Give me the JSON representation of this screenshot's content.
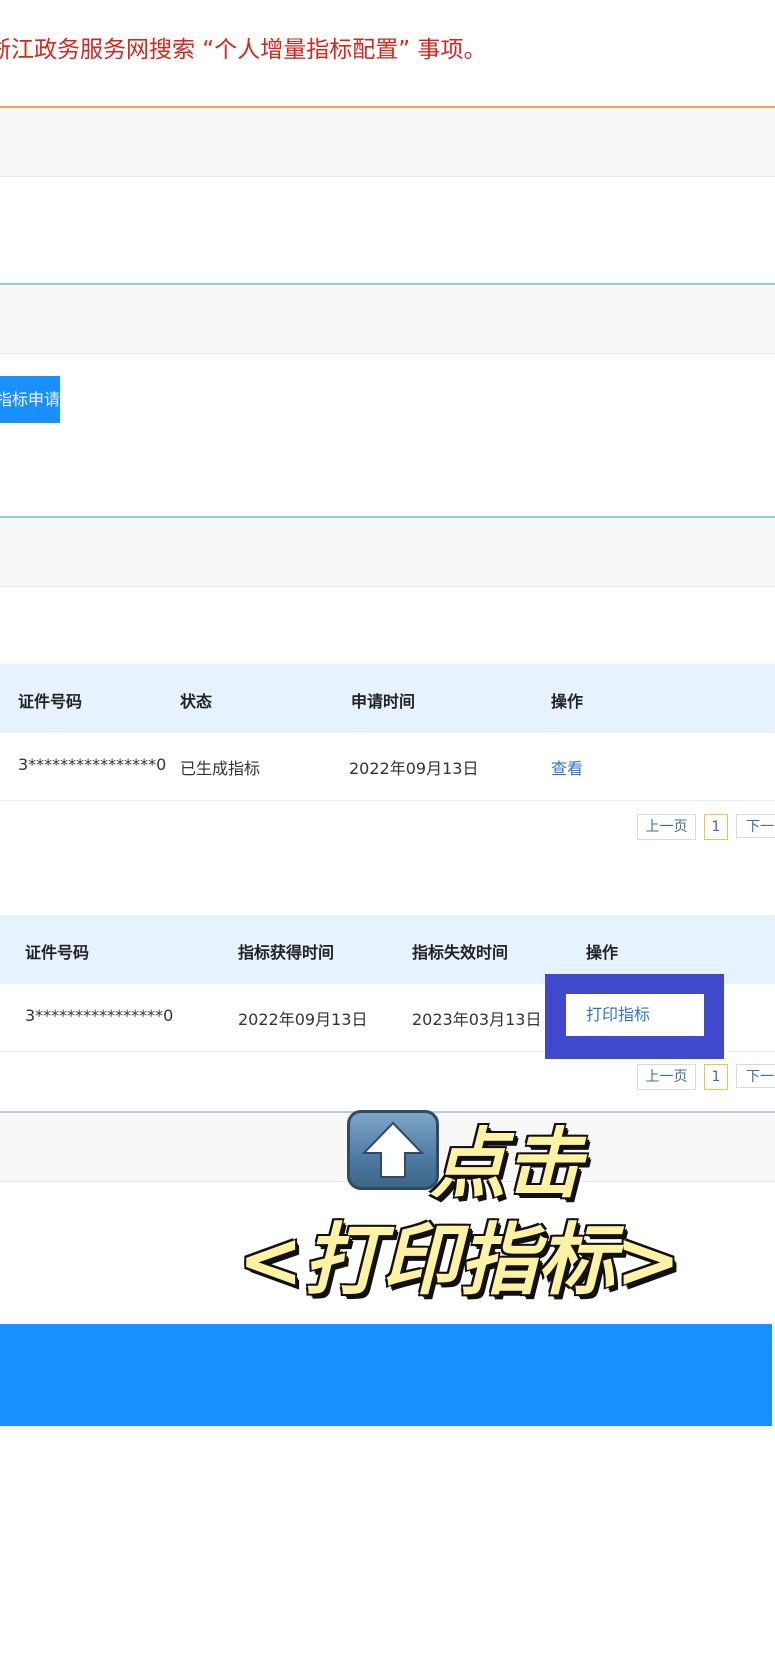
{
  "notice": {
    "text": "浙江政务服务网搜索 “个人增量指标配置” 事项。"
  },
  "apply_button": {
    "label": "指标申请"
  },
  "application_table": {
    "headers": [
      "证件号码",
      "状态",
      "申请时间",
      "操作"
    ],
    "rows": [
      {
        "id_number": "3****************0",
        "status": "已生成指标",
        "time": "2022年09月13日",
        "action": "查看"
      }
    ],
    "pagination": {
      "prev": "上一页",
      "current": "1",
      "next": "下一页"
    }
  },
  "quota_table": {
    "headers": [
      "证件号码",
      "指标获得时间",
      "指标失效时间",
      "操作"
    ],
    "rows": [
      {
        "id_number": "3****************0",
        "obtained": "2022年09月13日",
        "expires": "2023年03月13日",
        "action": "打印指标"
      }
    ],
    "pagination": {
      "prev": "上一页",
      "current": "1",
      "next": "下一页"
    }
  },
  "callout": {
    "line1": "点击",
    "line2": "<打印指标>",
    "icon": "up-arrow-icon"
  },
  "colors": {
    "notice_red": "#d7261d",
    "primary_blue": "#1890ff",
    "highlight_box": "#4049cc",
    "header_bg": "#e6f2fd",
    "callout_yellow": "#fff3a3"
  }
}
